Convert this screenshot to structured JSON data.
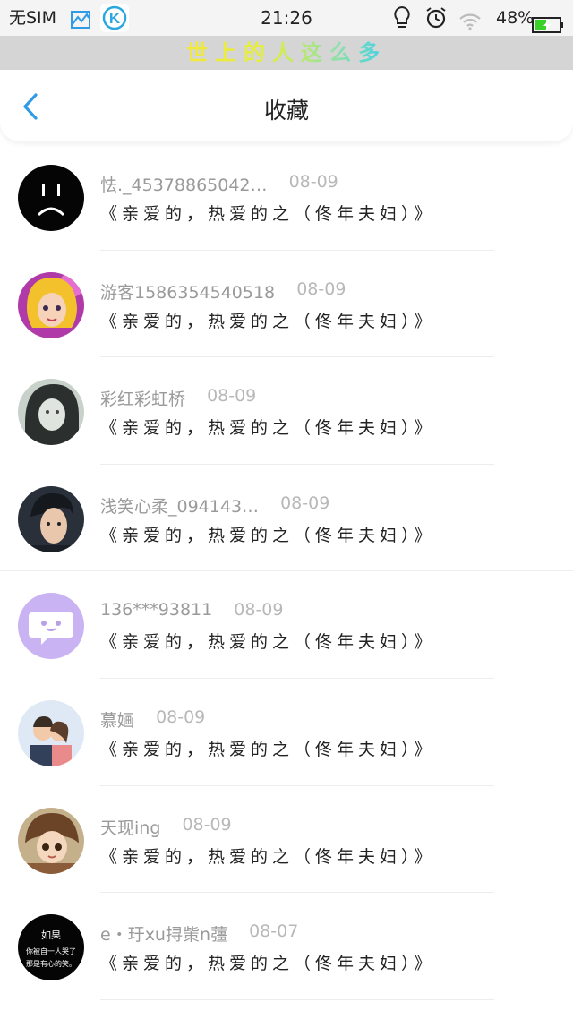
{
  "status_bar": {
    "sim": "无SIM",
    "time": "21:26",
    "battery": "48%",
    "battery_level": 0.48,
    "k_app_letter": "K",
    "icons": [
      "chart-icon",
      "k-app-icon",
      "bulb-icon",
      "alarm-icon",
      "wifi-icon",
      "battery-icon"
    ]
  },
  "banner": {
    "text": "世上的人这么多"
  },
  "header": {
    "title": "收藏",
    "back_icon": "chevron-left-icon"
  },
  "avatar_texts": {
    "rugo_lines": [
      "如果",
      "你被自一人哭了",
      "那是有心的笑。"
    ]
  },
  "favorites": [
    {
      "name": "怯._45378865042…",
      "date": "08-09",
      "content": "《亲爱的，热爱的之（佟年夫妇）》",
      "avatar": "sad-face"
    },
    {
      "name": "游客1586354540518",
      "date": "08-09",
      "content": "《亲爱的，热爱的之（佟年夫妇）》",
      "avatar": "doll-girl"
    },
    {
      "name": "彩红彩虹桥",
      "date": "08-09",
      "content": "《亲爱的，热爱的之（佟年夫妇）》",
      "avatar": "woman-portrait"
    },
    {
      "name": "浅笑心柔_094143…",
      "date": "08-09",
      "content": "《亲爱的，热爱的之（佟年夫妇）》",
      "avatar": "man-portrait"
    },
    {
      "name": "136***93811",
      "date": "08-09",
      "content": "《亲爱的，热爱的之（佟年夫妇）》",
      "avatar": "default-chat"
    },
    {
      "name": "慕婳",
      "date": "08-09",
      "content": "《亲爱的，热爱的之（佟年夫妇）》",
      "avatar": "couple-cartoon"
    },
    {
      "name": "天现ing",
      "date": "08-09",
      "content": "《亲爱的，热爱的之（佟年夫妇）》",
      "avatar": "anime-girl"
    },
    {
      "name": "e・玗xu挦㭰n䕬",
      "date": "08-07",
      "content": "《亲爱的，热爱的之（佟年夫妇）》",
      "avatar": "text-rugo"
    }
  ],
  "colors": {
    "accent": "#2f9be8",
    "banner_bg": "#d5d5d5",
    "name_text": "#9a9a9a",
    "date_text": "#b8b8b8",
    "battery_green": "#3bd12b"
  }
}
